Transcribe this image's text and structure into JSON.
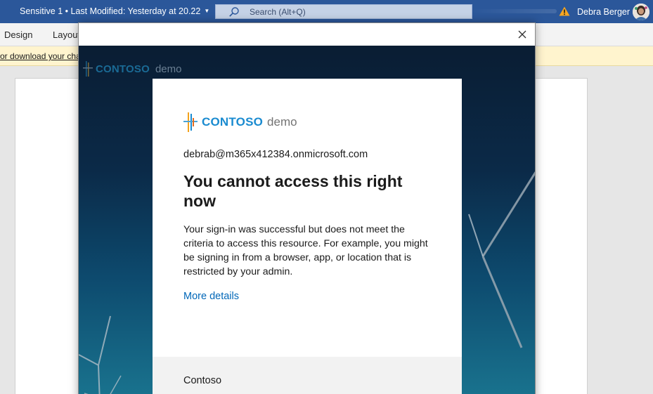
{
  "titlebar": {
    "doc_title": "Sensitive 1 • Last Modified: Yesterday at 20.22",
    "search_placeholder": "Search (Alt+Q)",
    "user_name": "Debra Berger",
    "search_icon": "search-icon",
    "warning_icon": "warning-icon",
    "bg_color": "#2b579a"
  },
  "ribbon": {
    "tabs": [
      "Design",
      "Layout"
    ]
  },
  "message_bar": {
    "text": "or download your cha",
    "bg_color": "#fff4ce"
  },
  "dialog": {
    "close_icon": "close-icon",
    "background_logo": {
      "word": "CONTOSO",
      "suffix": "demo"
    },
    "card": {
      "logo_word": "CONTOSO",
      "logo_suffix": "demo",
      "email": "debrab@m365x412384.onmicrosoft.com",
      "heading": "You cannot access this right now",
      "body": "Your sign-in was successful but does not meet the criteria to access this resource. For example, you might be signing in from a browser, app, or location that is restricted by your admin.",
      "link": "More details",
      "footer": "Contoso",
      "link_color": "#0067b8"
    }
  }
}
